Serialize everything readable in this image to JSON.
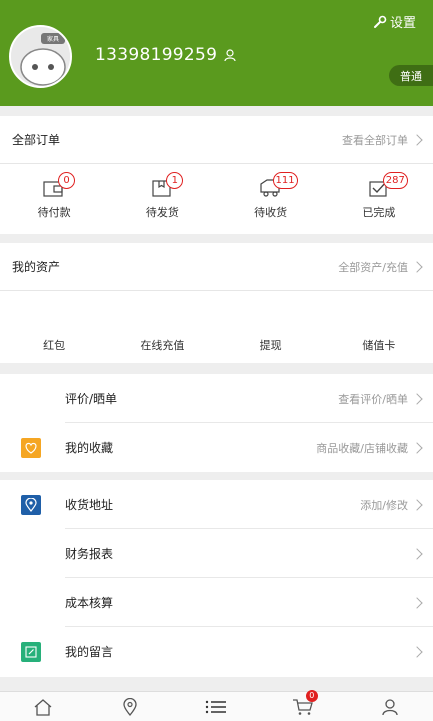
{
  "header": {
    "settings_label": "设置",
    "phone": "13398199259",
    "level": "普通",
    "avatar_text": "家具"
  },
  "orders": {
    "title": "全部订单",
    "link": "查看全部订单",
    "items": [
      {
        "label": "待付款",
        "count": "0",
        "icon": "wallet-icon"
      },
      {
        "label": "待发货",
        "count": "1",
        "icon": "package-icon"
      },
      {
        "label": "待收货",
        "count": "111",
        "icon": "truck-icon"
      },
      {
        "label": "已完成",
        "count": "287",
        "icon": "check-box-icon"
      }
    ]
  },
  "assets": {
    "title": "我的资产",
    "link": "全部资产/充值",
    "items": [
      {
        "label": "红包"
      },
      {
        "label": "在线充值"
      },
      {
        "label": "提现"
      },
      {
        "label": "储值卡"
      }
    ]
  },
  "menu1": [
    {
      "label": "评价/晒单",
      "link": "查看评价/晒单",
      "icon": ""
    },
    {
      "label": "我的收藏",
      "link": "商品收藏/店铺收藏",
      "icon": "heart-icon",
      "color": "#f5a623"
    }
  ],
  "menu2": [
    {
      "label": "收货地址",
      "link": "添加/修改",
      "icon": "location-icon",
      "color": "#1f5fa8"
    },
    {
      "label": "财务报表",
      "link": "",
      "icon": ""
    },
    {
      "label": "成本核算",
      "link": "",
      "icon": ""
    },
    {
      "label": "我的留言",
      "link": "",
      "icon": "edit-icon",
      "color": "#27b07a"
    }
  ],
  "tabbar": {
    "items": [
      {
        "name": "home-icon"
      },
      {
        "name": "location-pin-icon"
      },
      {
        "name": "list-icon"
      },
      {
        "name": "cart-icon",
        "badge": "0"
      },
      {
        "name": "user-icon"
      }
    ]
  },
  "colors": {
    "brand": "#5a9a1e",
    "badge": "#e02020"
  }
}
